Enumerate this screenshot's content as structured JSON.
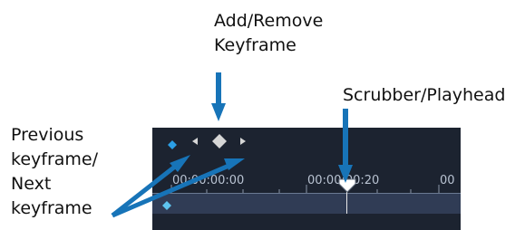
{
  "callouts": {
    "add_remove": [
      "Add/Remove",
      "Keyframe"
    ],
    "scrubber": "Scrubber/Playhead",
    "prev_next": [
      "Previous",
      "keyframe/",
      "Next",
      "keyframe"
    ]
  },
  "timeline": {
    "timecodes": [
      "00:00:00:00",
      "00:00:00:20",
      "00"
    ]
  },
  "colors": {
    "panel_bg": "#1c2330",
    "track_bg": "#303c55",
    "keyframe_active": "#2b9fe6",
    "keyframe_button": "#d6d6d6",
    "annotation_arrow": "#1774b8",
    "playhead": "#ffffff"
  },
  "icons": {
    "keyframe_indicator": "diamond-icon",
    "previous_keyframe": "triangle-left-icon",
    "add_remove_keyframe": "diamond-icon",
    "next_keyframe": "triangle-right-icon",
    "playhead": "playhead-marker-icon"
  }
}
